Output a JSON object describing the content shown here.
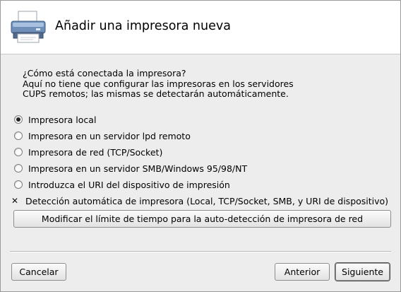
{
  "dialog": {
    "title": "Añadir una impresora nueva",
    "question_lines": [
      "¿Cómo está conectada la impresora?",
      "Aquí no tiene que configurar las impresoras en los servidores",
      "CUPS remotos; las mismas se detectarán automáticamente."
    ],
    "options": [
      {
        "label": "Impresora local",
        "selected": true
      },
      {
        "label": "Impresora en un servidor lpd remoto",
        "selected": false
      },
      {
        "label": "Impresora de red (TCP/Socket)",
        "selected": false
      },
      {
        "label": "Impresora en un servidor SMB/Windows 95/98/NT",
        "selected": false
      },
      {
        "label": "Introduzca el URI del dispositivo de impresión",
        "selected": false
      }
    ],
    "auto_detect": {
      "label": "Detección automática de impresora (Local, TCP/Socket, SMB, y URI de dispositivo)",
      "checked": true
    },
    "timeout_button": "Modificar el límite de tiempo para la auto-detección de impresora de red",
    "buttons": {
      "cancel": "Cancelar",
      "back": "Anterior",
      "next": "Siguiente"
    }
  }
}
